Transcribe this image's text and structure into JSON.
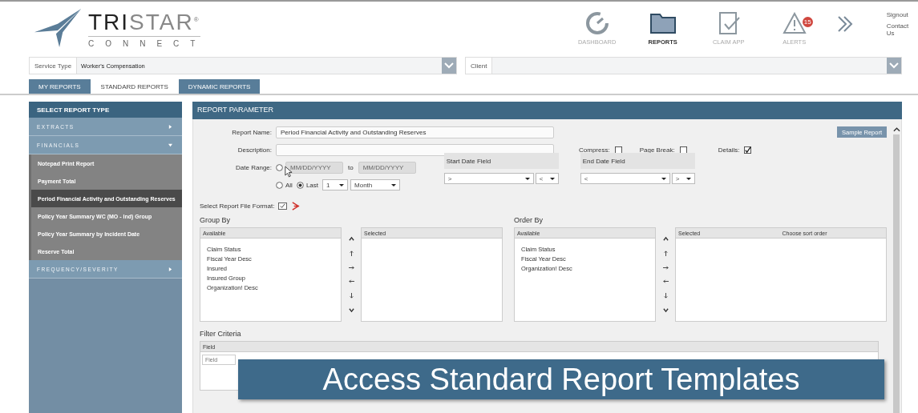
{
  "brand": {
    "name_dark": "TRI",
    "name_light": "STAR",
    "mark": "®",
    "sub": "CONNECT"
  },
  "nav": [
    {
      "label": "DASHBOARD",
      "kind": "gauge",
      "selected": false
    },
    {
      "label": "REPORTS",
      "kind": "folder",
      "selected": true
    },
    {
      "label": "CLAIM APP",
      "kind": "form",
      "selected": false
    },
    {
      "label": "ALERTS",
      "kind": "alert",
      "selected": false,
      "badge": "15"
    }
  ],
  "links": [
    "Signout",
    "Contact Us"
  ],
  "filters": [
    {
      "label": "Service Type",
      "value": "Worker's Compensation"
    },
    {
      "label": "Client"
    }
  ],
  "tabs": [
    {
      "label": "MY REPORTS",
      "selected": false
    },
    {
      "label": "STANDARD REPORTS",
      "selected": true
    },
    {
      "label": "DYNAMIC REPORTS",
      "selected": false
    }
  ],
  "sidebar": {
    "title": "SELECT REPORT TYPE",
    "sections": [
      {
        "label": "EXTRACTS",
        "expanded": false
      },
      {
        "label": "FINANCIALS",
        "expanded": true,
        "items": [
          {
            "label": "Notepad Print Report",
            "selected": false
          },
          {
            "label": "Payment Total",
            "selected": false
          },
          {
            "label": "Period Financial Activity and Outstanding Reserves",
            "selected": true
          },
          {
            "label": "Policy Year Summary WC (MO - Ind) Group",
            "selected": false
          },
          {
            "label": "Policy Year Summary by Incident Date",
            "selected": false
          },
          {
            "label": "Reserve Total",
            "selected": false
          }
        ]
      },
      {
        "label": "FREQUENCY/SEVERITY",
        "expanded": false
      }
    ]
  },
  "params": {
    "title": "REPORT PARAMETER",
    "report_name_label": "Report Name:",
    "report_name": "Period Financial Activity and Outstanding Reserves",
    "sample_button": "Sample Report",
    "description_label": "Description:",
    "options": [
      {
        "label": "Compress:",
        "checked": false
      },
      {
        "label": "Page Break:",
        "checked": false
      },
      {
        "label": "Details:",
        "checked": true
      }
    ],
    "date_range_label": "Date Range:",
    "range_selected": false,
    "from_placeholder": "MM/DD/YYYY",
    "to_label": "to",
    "to_placeholder": "MM/DD/YYYY",
    "all_label": "All",
    "all_selected": false,
    "last_label": "Last",
    "last_selected": true,
    "last_count": "1",
    "last_unit": "Month",
    "date_fields": [
      {
        "title": "Start Date Field",
        "value": ">",
        "op": "<"
      },
      {
        "title": "End Date Field",
        "value": "<",
        "op": ">"
      }
    ],
    "format_label": "Select Report File Format:",
    "lists": [
      {
        "title": "Group By",
        "available_header": "Available",
        "available": [
          "Claim Status",
          "Fiscal Year Desc",
          "Insured",
          "Insured Group",
          "Organization! Desc"
        ],
        "selected_headers": [
          "Selected"
        ]
      },
      {
        "title": "Order By",
        "available_header": "Available",
        "available": [
          "Claim Status",
          "Fiscal Year Desc",
          "Organization! Desc"
        ],
        "selected_headers": [
          "Selected",
          "Choose sort order"
        ]
      }
    ],
    "filter_title": "Filter Criteria",
    "filter_header": "Field",
    "filter_placeholder": "Field"
  },
  "caption": "Access Standard Report Templates"
}
